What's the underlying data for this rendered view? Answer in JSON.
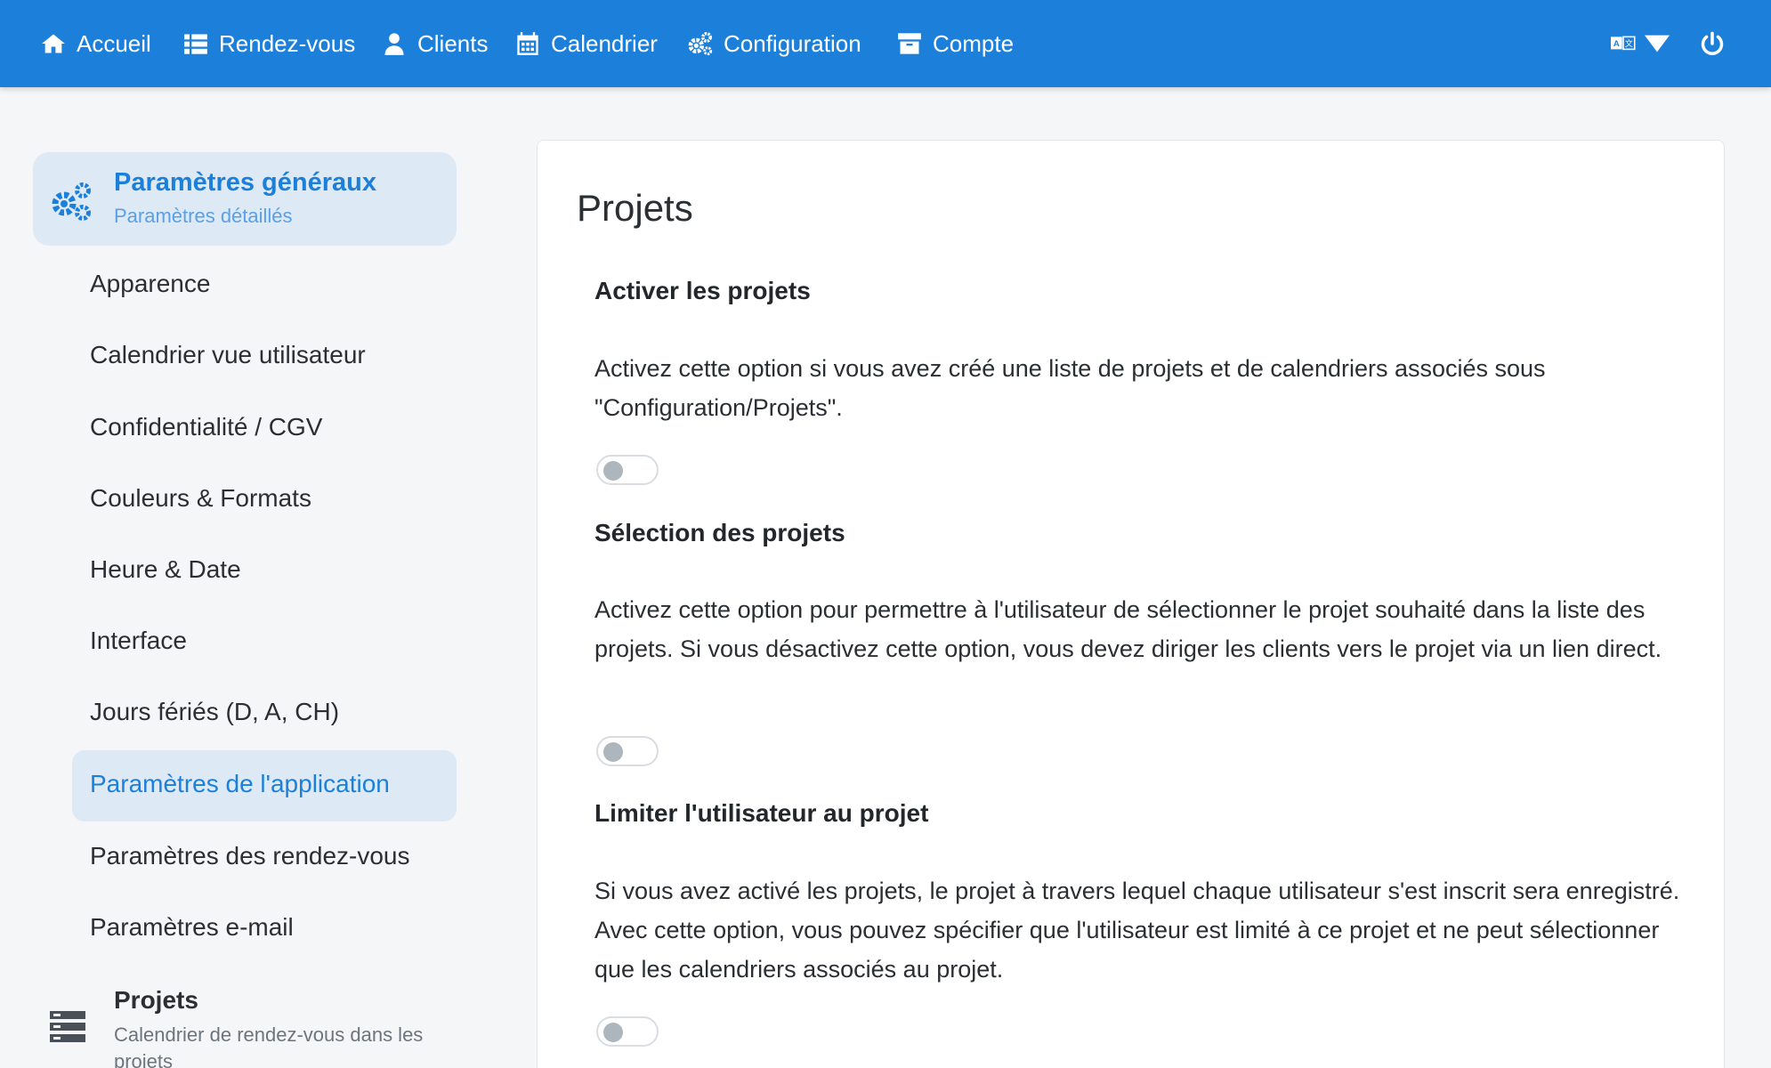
{
  "nav": {
    "items": [
      {
        "label": "Accueil",
        "icon": "home-icon"
      },
      {
        "label": "Rendez-vous",
        "icon": "list-icon"
      },
      {
        "label": "Clients",
        "icon": "user-icon"
      },
      {
        "label": "Calendrier",
        "icon": "calendar-icon"
      },
      {
        "label": "Configuration",
        "icon": "cogs-icon"
      },
      {
        "label": "Compte",
        "icon": "archive-icon"
      }
    ],
    "language_icon": "language-icon",
    "power_icon": "power-icon",
    "bg_color": "#1c80db"
  },
  "sidebar": {
    "header": {
      "title": "Paramètres généraux",
      "subtitle": "Paramètres détaillés"
    },
    "items": [
      {
        "label": "Apparence"
      },
      {
        "label": "Calendrier vue utilisateur"
      },
      {
        "label": "Confidentialité / CGV"
      },
      {
        "label": "Couleurs & Formats"
      },
      {
        "label": "Heure & Date"
      },
      {
        "label": "Interface"
      },
      {
        "label": "Jours fériés (D, A, CH)"
      },
      {
        "label": "Paramètres de l'application"
      },
      {
        "label": "Paramètres des rendez-vous"
      },
      {
        "label": "Paramètres e-mail"
      }
    ],
    "active_item": "Paramètres de l'application",
    "sub_section": {
      "title": "Projets",
      "subtitle": "Calendrier de rendez-vous dans les projets"
    }
  },
  "main": {
    "title": "Projets",
    "sections": [
      {
        "title": "Activer les projets",
        "text": "Activez cette option si vous avez créé une liste de projets et de calendriers associés sous \"Configuration/Projets\".",
        "enabled": false
      },
      {
        "title": "Sélection des projets",
        "text": "Activez cette option pour permettre à l'utilisateur de sélectionner le projet souhaité dans la liste des projets. Si vous désactivez cette option, vous devez diriger les clients vers le projet via un lien direct.",
        "enabled": false
      },
      {
        "title": "Limiter l'utilisateur au projet",
        "text": "Si vous avez activé les projets, le projet à travers lequel chaque utilisateur s'est inscrit sera enregistré. Avec cette option, vous pouvez spécifier que l'utilisateur est limité à ce projet et ne peut sélectionner que les calendriers associés au projet.",
        "enabled": false
      }
    ]
  }
}
